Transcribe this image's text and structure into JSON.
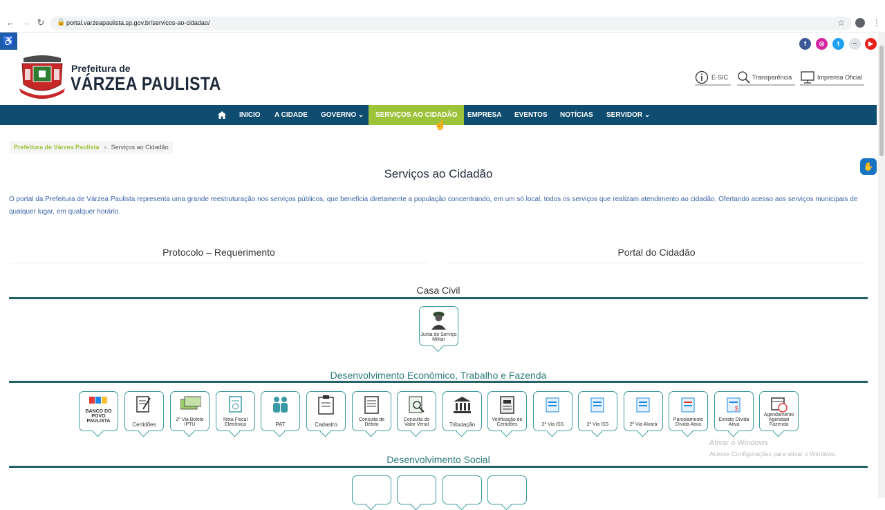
{
  "browser": {
    "url": "portal.varzeapaulista.sp.gov.br/servicos-ao-cidadao/"
  },
  "header": {
    "brand_top": "Prefeitura de",
    "brand_main": "VÁRZEA PAULISTA",
    "utils": [
      "E-SIC",
      "Transparência",
      "Imprensa Oficial"
    ]
  },
  "nav": {
    "items": [
      "INICIO",
      "A CIDADE",
      "GOVERNO",
      "SERVIÇOS AO CIDADÃO",
      "EMPRESA",
      "EVENTOS",
      "NOTÍCIAS",
      "SERVIDOR"
    ],
    "active": "SERVIÇOS AO CIDADÃO"
  },
  "breadcrumb": {
    "home": "Prefeitura de Várzea Paulista",
    "sep": "»",
    "current": "Serviços ao Cidadão"
  },
  "page": {
    "title": "Serviços ao Cidadão",
    "intro": "O portal da Prefeitura de Várzea Paulista representa uma grande reestruturação nos serviços públicos, que beneficia diretamente a população concentrando, em um só local, todos os serviços que realizam atendimento ao cidadão. Ofertando acesso aos serviços municipais de qualquer lugar, em qualquer horário."
  },
  "services": {
    "left": "Protocolo – Requerimento",
    "right": "Portal do Cidadão"
  },
  "sections": {
    "casa_civil": {
      "title": "Casa Civil",
      "tiles": [
        {
          "label": "Junta do Serviço Militar"
        }
      ]
    },
    "desenvolvimento": {
      "title": "Desenvolvimento Econômico, Trabalho e Fazenda",
      "tiles": [
        {
          "label": "BANCO DO POVO PAULISTA"
        },
        {
          "label": "Certidões"
        },
        {
          "label": "2ª Via Boleto IPTU"
        },
        {
          "label": "Nota Fiscal Eletrônica"
        },
        {
          "label": "PAT"
        },
        {
          "label": "Cadastro"
        },
        {
          "label": "Consulta de Débito"
        },
        {
          "label": "Consulta do Valor Venal"
        },
        {
          "label": "Tributação"
        },
        {
          "label": "Verificação de Certidões"
        },
        {
          "label": "2ª Via ISS"
        },
        {
          "label": "2ª Via ISS"
        },
        {
          "label": "2ª Via Alvará"
        },
        {
          "label": "Parcelamento Dívida Ativa"
        },
        {
          "label": "Extrato Dívida Ativa"
        },
        {
          "label": "Agendamento Agendaai Fazenda"
        }
      ]
    },
    "social": {
      "title": "Desenvolvimento Social"
    }
  },
  "watermark": {
    "line1": "Ativar o Windows",
    "line2": "Acesse Configurações para ativar o Windows."
  },
  "colors": {
    "nav_bg": "#0e4c70",
    "nav_active": "#9dc33b",
    "section_line": "#256266",
    "tile_border": "#3a9aa3"
  }
}
